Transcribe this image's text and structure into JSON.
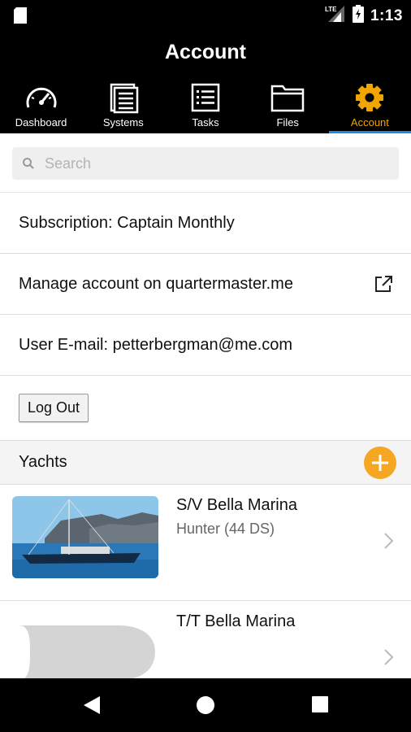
{
  "status_bar": {
    "time": "1:13",
    "network": "LTE",
    "icons": [
      "sd-card-icon",
      "signal-icon",
      "battery-charging-icon"
    ]
  },
  "header": {
    "title": "Account"
  },
  "tabs": [
    {
      "label": "Dashboard",
      "icon": "speedometer-icon",
      "active": false
    },
    {
      "label": "Systems",
      "icon": "document-list-icon",
      "active": false
    },
    {
      "label": "Tasks",
      "icon": "checklist-icon",
      "active": false
    },
    {
      "label": "Files",
      "icon": "folder-icon",
      "active": false
    },
    {
      "label": "Account",
      "icon": "gear-icon",
      "active": true
    }
  ],
  "search": {
    "placeholder": "Search",
    "value": ""
  },
  "account": {
    "subscription": "Subscription: Captain Monthly",
    "manage": "Manage account on quartermaster.me",
    "email": "User E-mail: petterbergman@me.com",
    "logout_label": "Log Out"
  },
  "yachts_section": {
    "title": "Yachts",
    "items": [
      {
        "name": "S/V Bella Marina",
        "model": "Hunter (44 DS)"
      },
      {
        "name": "T/T Bella Marina",
        "model": ""
      }
    ]
  },
  "colors": {
    "accent": "#f0a500",
    "add_button": "#f5a623",
    "tab_indicator": "#1e88e5"
  }
}
